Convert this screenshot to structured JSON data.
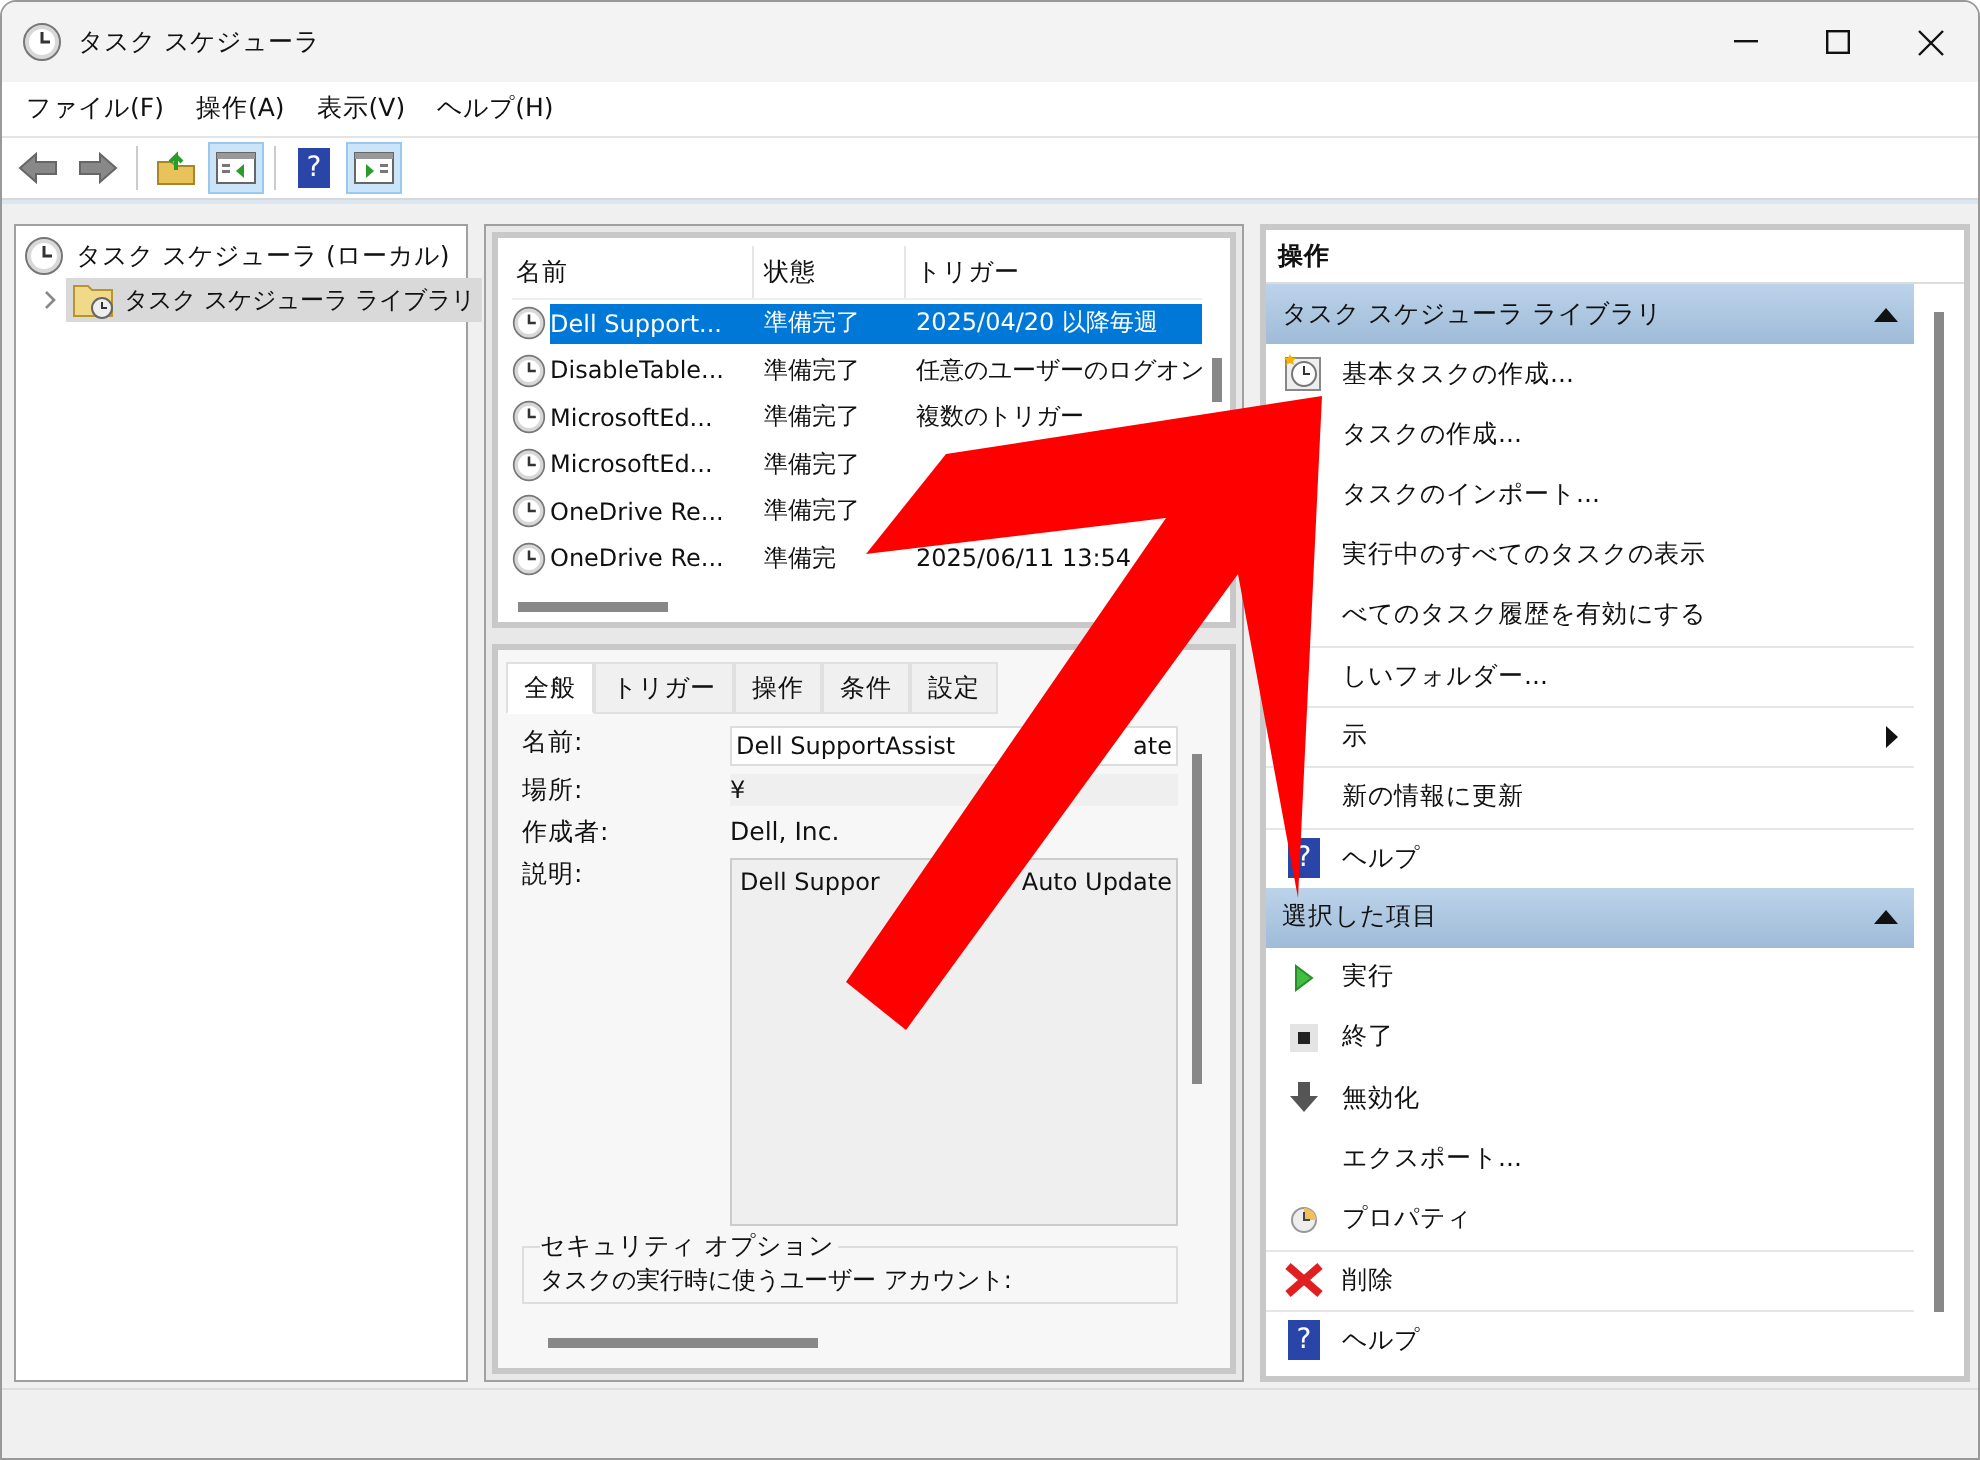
{
  "window": {
    "title": "タスク スケジューラ"
  },
  "menu": [
    "ファイル(F)",
    "操作(A)",
    "表示(V)",
    "ヘルプ(H)"
  ],
  "toolbar": [
    [
      {
        "kind": "back",
        "pressed": false
      },
      {
        "kind": "forward",
        "pressed": false
      }
    ],
    [
      {
        "kind": "up",
        "pressed": false
      },
      {
        "kind": "tree",
        "pressed": true
      }
    ],
    [
      {
        "kind": "help",
        "pressed": false,
        "glyph": "?"
      },
      {
        "kind": "actions",
        "pressed": true
      }
    ]
  ],
  "tree": {
    "label": "タスク スケジューラ (ローカル)",
    "children": [
      {
        "label": "タスク スケジューラ ライブラリ",
        "selected": true,
        "expanded": false
      }
    ]
  },
  "task_list": {
    "columns": [
      "名前",
      "状態",
      "トリガー"
    ],
    "rows": [
      {
        "name": "Dell Support...",
        "status": "準備完了",
        "trigger": "2025/04/20 以降毎週",
        "selected": true
      },
      {
        "name": "DisableTable...",
        "status": "準備完了",
        "trigger": "任意のユーザーのログオン",
        "selected": false
      },
      {
        "name": "MicrosoftEd...",
        "status": "準備完了",
        "trigger": "複数のトリガー",
        "selected": false
      },
      {
        "name": "MicrosoftEd...",
        "status": "準備完了",
        "selected": false
      },
      {
        "name": "OneDrive Re...",
        "status": "準備完了",
        "selected": false
      },
      {
        "name": "OneDrive Re...",
        "status": "準備完",
        "trigger": "2025/06/11 13:54",
        "selected": false
      }
    ]
  },
  "details": {
    "tabs": [
      {
        "label": "全般",
        "selected": true
      },
      {
        "label": "トリガー",
        "selected": false
      },
      {
        "label": "操作",
        "selected": false
      },
      {
        "label": "条件",
        "selected": false
      },
      {
        "label": "設定",
        "selected": false
      }
    ],
    "fields": [
      {
        "label": "名前:",
        "kind": "input",
        "value": [
          "Dell SupportAssist",
          "ate"
        ]
      },
      {
        "label": "場所:",
        "kind": "readonly",
        "value": [
          "¥"
        ]
      },
      {
        "label": "作成者:",
        "kind": "plain",
        "value": [
          "Dell, Inc."
        ]
      },
      {
        "label": "説明:",
        "kind": "textarea",
        "value": [
          "Dell Suppor",
          "Auto Update"
        ]
      }
    ],
    "security": {
      "title": "セキュリティ オプション",
      "text": "タスクの実行時に使うユーザー アカウント:"
    }
  },
  "actions": {
    "title": "操作",
    "sections": [
      {
        "title": "タスク スケジューラ ライブラリ",
        "expanded": true,
        "groups": [
          [
            {
              "label": "基本タスクの作成...",
              "kind": "basic-task"
            },
            {
              "label": "タスクの作成...",
              "kind": "plain"
            },
            {
              "label": "タスクのインポート...",
              "kind": "plain"
            },
            {
              "label": "実行中のすべてのタスクの表示",
              "kind": "plain"
            },
            {
              "label": "べてのタスク履歴を有効にする",
              "kind": "plain"
            }
          ],
          [
            {
              "label": "しいフォルダー...",
              "kind": "plain"
            }
          ],
          [
            {
              "label": "示",
              "kind": "submenu"
            }
          ],
          [
            {
              "label": "新の情報に更新",
              "kind": "plain"
            }
          ],
          [
            {
              "label": "ヘルプ",
              "kind": "help",
              "glyph": "?"
            }
          ]
        ]
      },
      {
        "title": "選択した項目",
        "expanded": true,
        "groups": [
          [
            {
              "label": "実行",
              "kind": "run"
            },
            {
              "label": "終了",
              "kind": "stop"
            },
            {
              "label": "無効化",
              "kind": "disable"
            },
            {
              "label": "エクスポート...",
              "kind": "plain"
            },
            {
              "label": "プロパティ",
              "kind": "properties"
            }
          ],
          [
            {
              "label": "削除",
              "kind": "delete"
            }
          ],
          [
            {
              "label": "ヘルプ",
              "kind": "help",
              "glyph": "?"
            }
          ]
        ]
      }
    ]
  }
}
